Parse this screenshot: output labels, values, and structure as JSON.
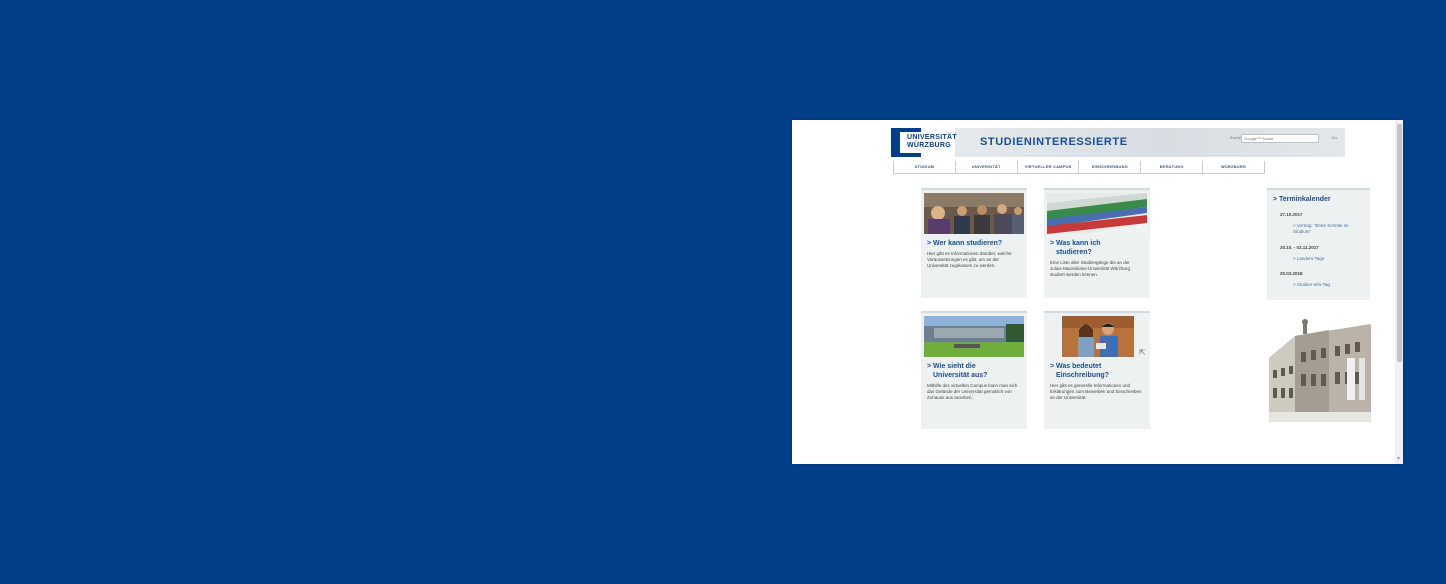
{
  "header": {
    "logo_line1": "UNIVERSITÄT",
    "logo_line2": "WÜRZBURG",
    "title": "STUDIENINTERESSIERTE",
    "search_label": "Suche",
    "search_placeholder": "Google™ Suche",
    "search_button": "Go"
  },
  "nav": {
    "items": [
      "STUDIUM",
      "UNIVERSITÄT",
      "VIRTUELLER CAMPUS",
      "EINSCHREIBUNG",
      "BERATUNG",
      "WÜRZBURG"
    ]
  },
  "cards": [
    {
      "heading_line1": "> Wer kann studieren?",
      "heading_line2": "",
      "desc": "Hier gibt es Informationen darüber, welche Voraussetzungen es gibt, um an der Universität zugelassen zu werden."
    },
    {
      "heading_line1": "> Was kann ich",
      "heading_line2": "studieren?",
      "desc": "Eine Liste aller Studiengänge die an der Julius-Maximilians-Universität Würzburg studiert werden können."
    },
    {
      "heading_line1": "> Wie sieht die",
      "heading_line2": "Universität aus?",
      "desc": "Mithilfe des virtuellen Campus kann man sich das Gelände der Universität gemütlich von Zuhause aus ansehen."
    },
    {
      "heading_line1": "> Was bedeutet",
      "heading_line2": "Einschreibung?",
      "desc": "Hier gibt es generelle Informationen und Erklärungen zum Bewerben und Einschreiben an der Universität."
    }
  ],
  "calendar": {
    "title": "> Terminkalender",
    "entries": [
      {
        "date": "27.10.2017",
        "event": "> Vortrag: \"Erste Schritte im Studium\""
      },
      {
        "date": "30.10. - 03.11.2017",
        "event": "> Landers-Tage"
      },
      {
        "date": "20.02.2018",
        "event": "> Studien-Info-Tag"
      }
    ]
  },
  "icons": {
    "scroll_down": "scroll-down-arrow-icon",
    "cursor": "mouse-cursor-icon"
  },
  "colors": {
    "background": "#003f87",
    "brand_blue": "#1a4f8f",
    "card_bg": "#eef1f2"
  }
}
